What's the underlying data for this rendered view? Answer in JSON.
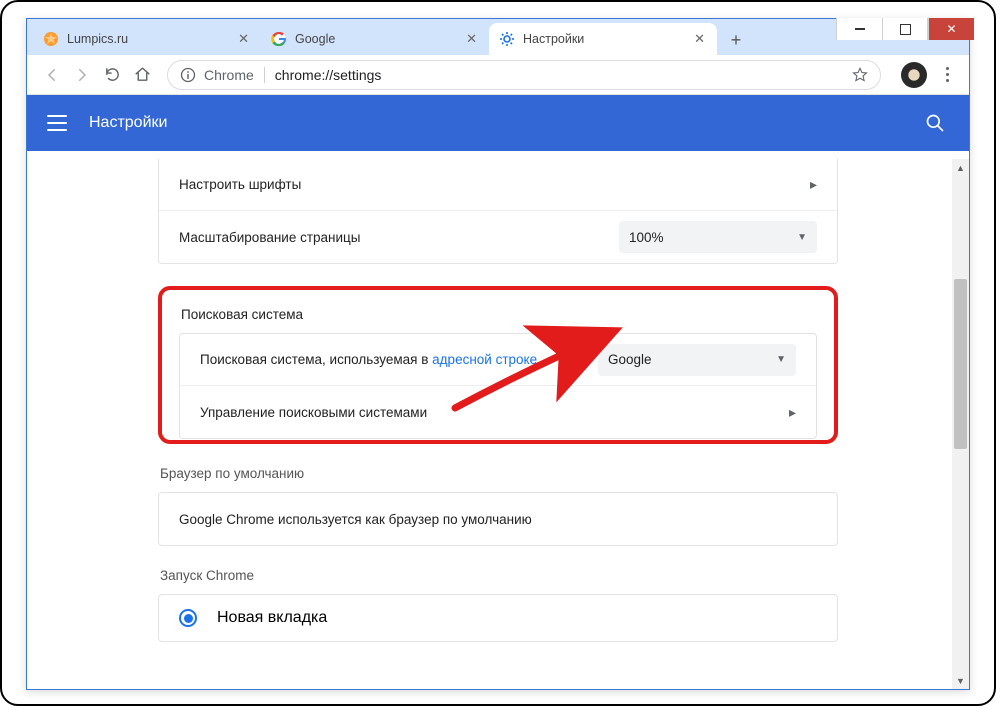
{
  "window": {
    "tabs": [
      {
        "label": "Lumpics.ru",
        "active": false,
        "favicon": "lumpics"
      },
      {
        "label": "Google",
        "active": false,
        "favicon": "google"
      },
      {
        "label": "Настройки",
        "active": true,
        "favicon": "gear"
      }
    ]
  },
  "omnibox": {
    "scheme": "Chrome",
    "url": "chrome://settings"
  },
  "blueheader": {
    "title": "Настройки"
  },
  "sections": {
    "appearance_card": {
      "row_fonts": "Настроить шрифты",
      "row_zoom": "Масштабирование страницы",
      "zoom_value": "100%"
    },
    "search": {
      "title": "Поисковая система",
      "row1_prefix": "Поисковая система, используемая в ",
      "row1_link": "адресной строке",
      "engine_value": "Google",
      "row2": "Управление поисковыми системами"
    },
    "default_browser": {
      "title": "Браузер по умолчанию",
      "text": "Google Chrome используется как браузер по умолчанию"
    },
    "startup": {
      "title": "Запуск Chrome",
      "opt1": "Новая вкладка"
    }
  }
}
